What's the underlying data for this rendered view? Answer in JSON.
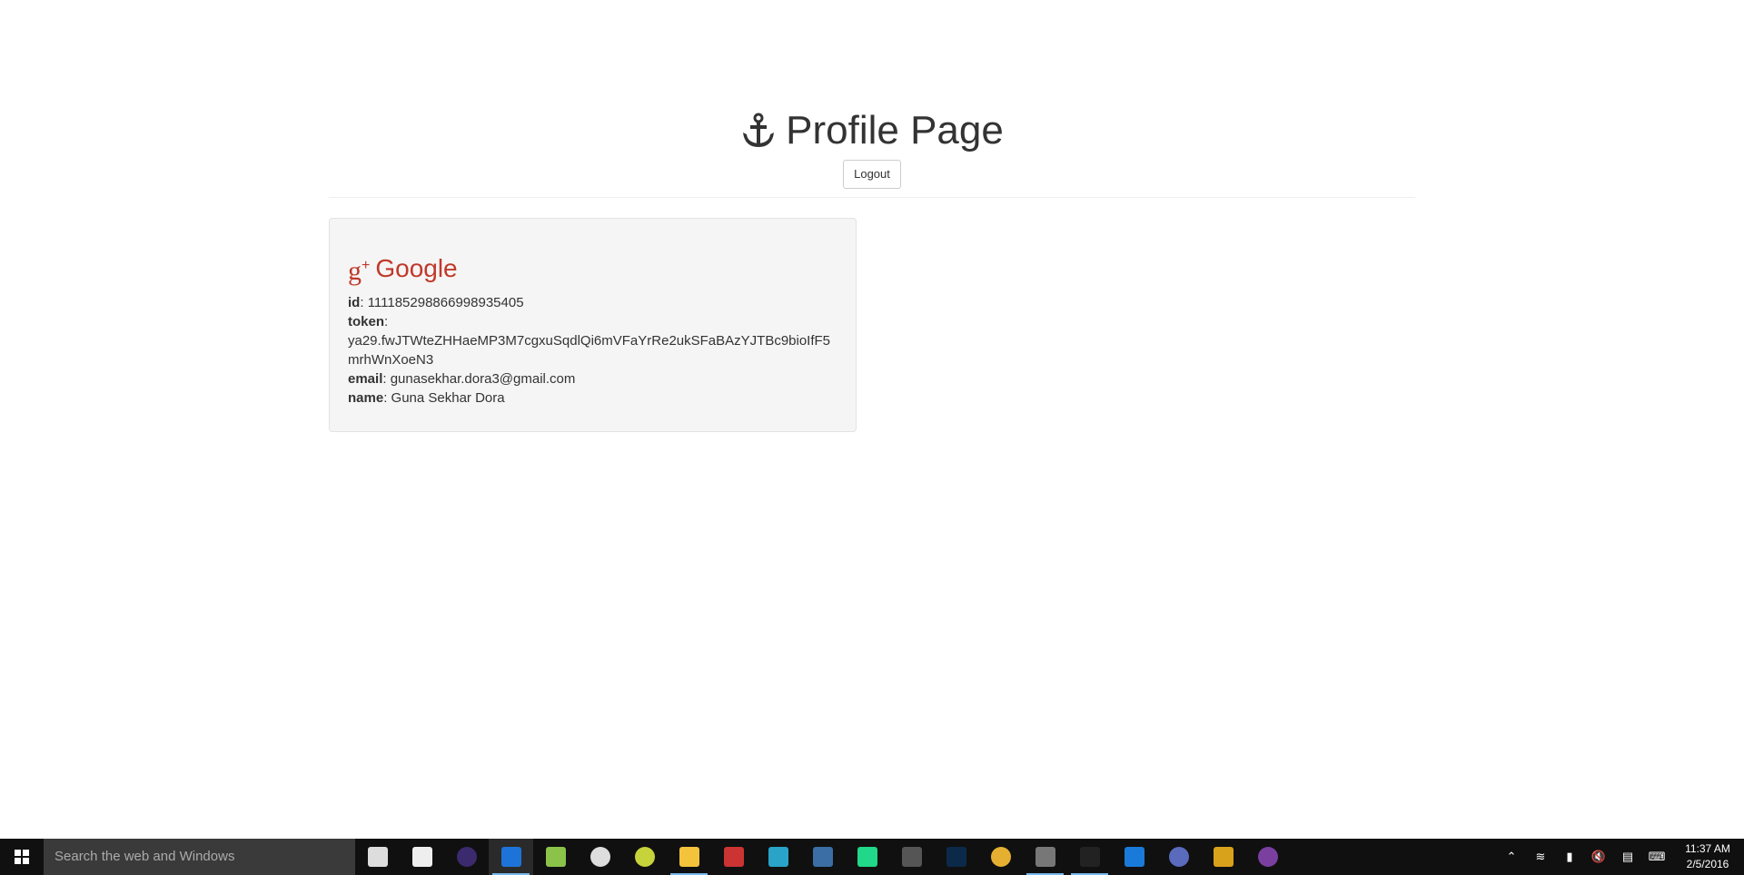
{
  "header": {
    "title": "Profile Page",
    "logout_label": "Logout"
  },
  "google": {
    "heading": "Google",
    "fields": [
      {
        "label": "id",
        "value": "111185298866998935405"
      },
      {
        "label": "token",
        "value": "ya29.fwJTWteZHHaeMP3M7cgxuSqdlQi6mVFaYrRe2ukSFaBAzYJTBc9bioIfF5mrhWnXoeN3"
      },
      {
        "label": "email",
        "value": "gunasekhar.dora3@gmail.com"
      },
      {
        "label": "name",
        "value": "Guna Sekhar Dora"
      }
    ],
    "accent": "#c0392b"
  },
  "taskbar": {
    "search_placeholder": "Search the web and Windows",
    "apps": [
      {
        "name": "task-view",
        "color": "#ddd"
      },
      {
        "name": "store",
        "color": "#eee"
      },
      {
        "name": "eclipse",
        "color": "#3b2a6e"
      },
      {
        "name": "edge",
        "color": "#1e73d8"
      },
      {
        "name": "notepad-plus",
        "color": "#8bc34a"
      },
      {
        "name": "groove",
        "color": "#ddd"
      },
      {
        "name": "app-green",
        "color": "#c6d33a"
      },
      {
        "name": "file-explorer",
        "color": "#f3c33c"
      },
      {
        "name": "app-red",
        "color": "#c33"
      },
      {
        "name": "app-diamond",
        "color": "#2aa3c9"
      },
      {
        "name": "python",
        "color": "#3a6ea5"
      },
      {
        "name": "pycharm",
        "color": "#21d789"
      },
      {
        "name": "cmd",
        "color": "#555"
      },
      {
        "name": "photoshop",
        "color": "#0b2a4a"
      },
      {
        "name": "chrome",
        "color": "#e5b031"
      },
      {
        "name": "sublime",
        "color": "#777"
      },
      {
        "name": "terminal",
        "color": "#222"
      },
      {
        "name": "app-blue",
        "color": "#1a7ad9"
      },
      {
        "name": "app-planet",
        "color": "#5a6bbd"
      },
      {
        "name": "app-yellow",
        "color": "#d8a21b"
      },
      {
        "name": "app-purple",
        "color": "#7b3fa0"
      }
    ],
    "time": "11:37 AM",
    "date": "2/5/2016"
  }
}
